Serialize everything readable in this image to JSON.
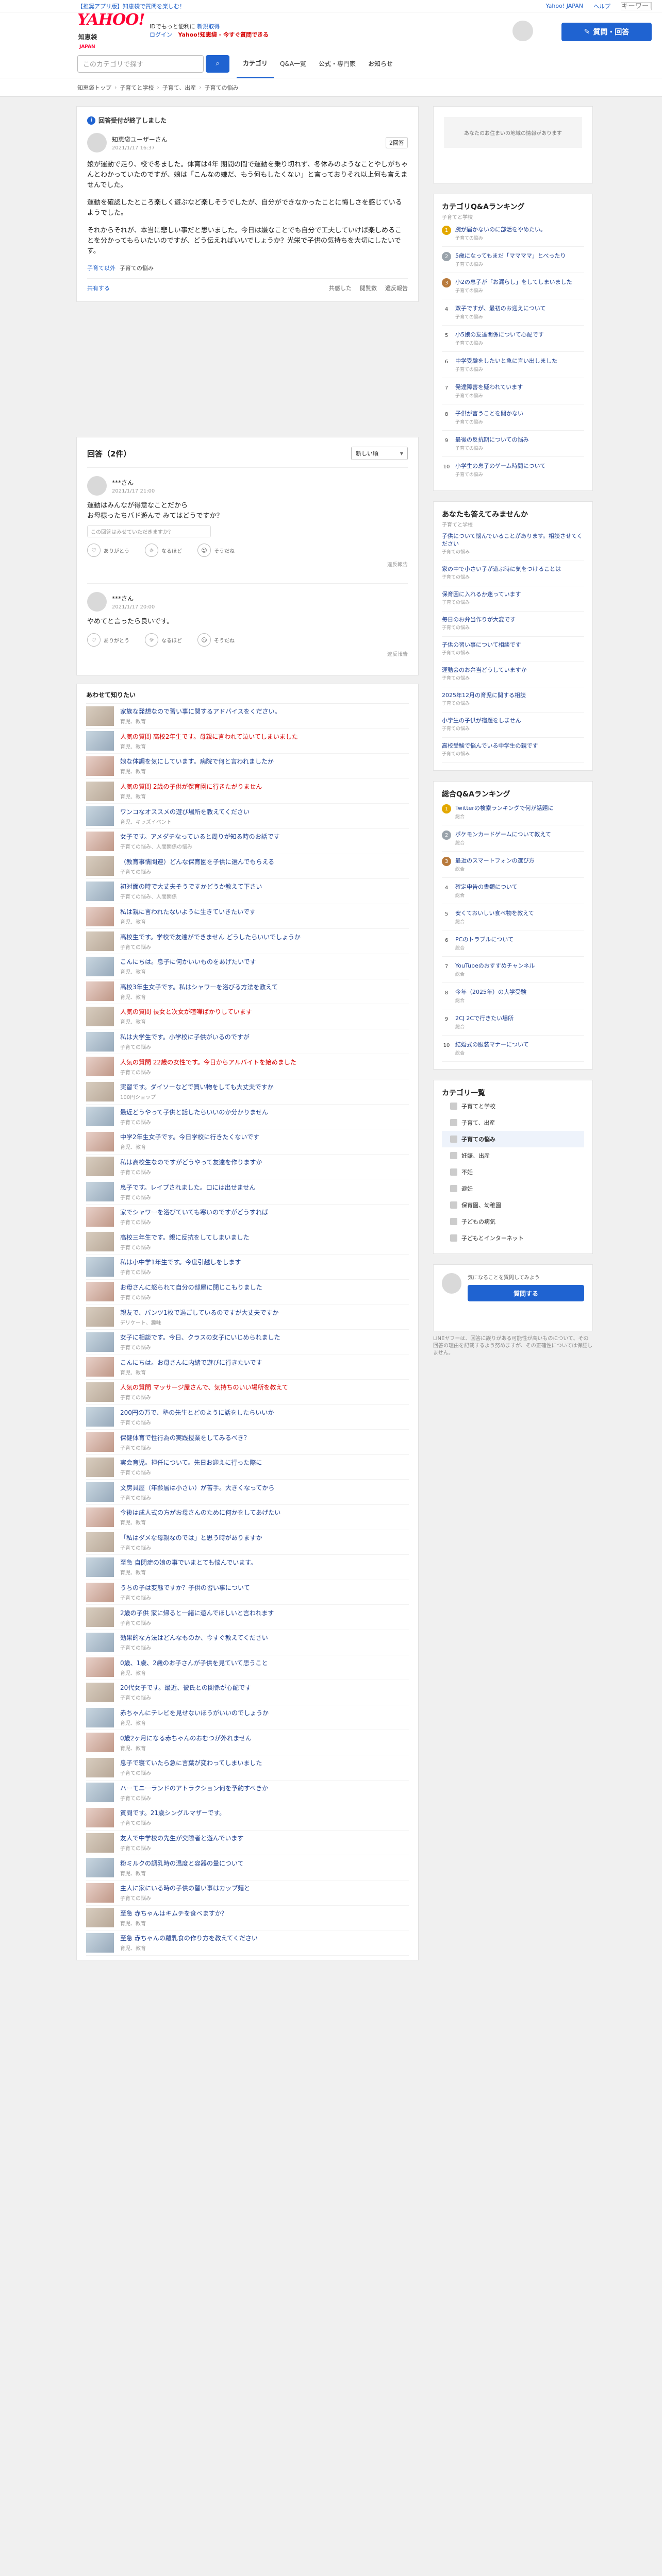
{
  "topbar": {
    "left_link": "【推奨アプリ版】知恵袋で質問を楽しむ！",
    "right": [
      "Yahoo! JAPAN",
      "ヘルプ",
      "キーワード検索"
    ]
  },
  "header": {
    "logo": "YAHOO!",
    "logo_sub": "知恵袋",
    "logo_jp": "JAPAN",
    "greeting": "IDでもっと便利に",
    "greeting_link": "新規取得",
    "login": "ログイン",
    "promo": "Yahoo!知恵袋 - 今すぐ質問できる",
    "ask_button": "質問・回答"
  },
  "subnav": [
    "知恵袋トップ",
    "子育てと学校",
    "子育て、出産",
    "子育ての悩み"
  ],
  "search": {
    "placeholder": "このカテゴリで探す",
    "tabs": [
      "カテゴリ",
      "Q&A一覧",
      "公式・専門家",
      "お知らせ"
    ]
  },
  "question": {
    "resolved": "回答受付が終了しました",
    "user": "知恵袋ユーザーさん",
    "date": "2021/1/17 16:37",
    "answer_count": "2回答",
    "body": [
      "娘が運動で走り、校で冬ました。体育は4年 期間の間で運動を乗り切れず、冬休みのようなことやしがちゃんとわかっていたのですが、娘は「こんなの嫌だ、もう何もしたくない」と言っておりそれ以上何も言えませんでした。",
      "運動を確認したところ楽しく遊ぶなど楽しそうでしたが、自分ができなかったことに悔しさを感じているようでした。",
      "それからそれが、本当に悲しい事だと思いました。今日は嫌なことでも自分で工夫していけば楽しめることを分かってもらいたいのですが、どう伝えればいいでしょうか？光栄で子供の気持ちを大切にしたいです。"
    ],
    "tag": "子育て以外",
    "category": "子育ての悩み",
    "actions": [
      "共感した",
      "閲覧数",
      "違反報告"
    ],
    "share": "共有する"
  },
  "answers": {
    "title": "回答（2件）",
    "sort": "新しい順",
    "items": [
      {
        "user": "***さん",
        "date": "2021/1/17 21:00",
        "text": "運動はみんなが得意なことだから\nお母様ったちバド遊んで みてはどうですか？",
        "ref": "この回答はみせていただきますか？",
        "reactions": [
          "ありがとう",
          "なるほど",
          "そうだね"
        ],
        "report": "違反報告"
      },
      {
        "user": "***さん",
        "date": "2021/1/17 20:00",
        "text": "やめてと言ったら良いです。",
        "reactions": [
          "ありがとう",
          "なるほど",
          "そうだね"
        ],
        "report": "違反報告"
      }
    ]
  },
  "related": {
    "title": "あわせて知りたい",
    "items": [
      {
        "t": "家族な発想なので習い事に関するアドバイスをください。",
        "s": "育児、教育"
      },
      {
        "t": "人気の質問 高校2年生です。母親に言われて泣いてしまいました",
        "s": "育児、教育",
        "pop": true
      },
      {
        "t": "娘な体調を気にしています。病院で何と言われましたか",
        "s": "育児、教育"
      },
      {
        "t": "人気の質問 2歳の子供が保育園に行きたがりません",
        "s": "育児、教育",
        "pop": true
      },
      {
        "t": "ワンコなオススメの遊び場所を教えてください",
        "s": "育児、キッズイベント"
      },
      {
        "t": "女子です。アメダチなっていると周りが知る時のお話です",
        "s": "子育ての悩み、人間関係の悩み"
      },
      {
        "t": "（教育事情関連）どんな保育園を子供に選んでもらえる",
        "s": "子育ての悩み"
      },
      {
        "t": "初対面の時で大丈夫そうですかどうか教えて下さい",
        "s": "子育ての悩み、人間関係"
      },
      {
        "t": "私は親に言われたないように生きていきたいです",
        "s": "育児、教育"
      },
      {
        "t": "高校生です。学校で友達ができません どうしたらいいでしょうか",
        "s": "子育ての悩み"
      },
      {
        "t": "こんにちは。息子に何かいいものをあげたいです",
        "s": "育児、教育"
      },
      {
        "t": "高校3年生女子です。私はシャワーを浴びる方法を教えて",
        "s": "育児、教育"
      },
      {
        "t": "人気の質問 長女と次女が喧嘩ばかりしています",
        "s": "育児、教育",
        "pop": true
      },
      {
        "t": "私は大学生です。小学校に子供がいるのですが",
        "s": "子育ての悩み"
      },
      {
        "t": "人気の質問 22歳の女性です。今日からアルバイトを始めました",
        "s": "子育ての悩み",
        "pop": true
      },
      {
        "t": "実習です。ダイソーなどで買い物をしても大丈夫ですか",
        "s": "100円ショップ"
      },
      {
        "t": "最近どうやって子供と話したらいいのか分かりません",
        "s": "子育ての悩み"
      },
      {
        "t": "中学2年生女子です。今日学校に行きたくないです",
        "s": "育児、教育"
      },
      {
        "t": "私は高校生なのですがどうやって友達を作りますか",
        "s": "子育ての悩み"
      },
      {
        "t": "息子です。レイプされました。口には出せません",
        "s": "子育ての悩み"
      },
      {
        "t": "家でシャワーを浴びていても寒いのですがどうすれば",
        "s": "子育ての悩み"
      },
      {
        "t": "高校三年生です。親に反抗をしてしまいました",
        "s": "子育ての悩み"
      },
      {
        "t": "私は小中学1年生です。今度引越しをします",
        "s": "子育ての悩み"
      },
      {
        "t": "お母さんに怒られて自分の部屋に閉じこもりました",
        "s": "子育ての悩み"
      },
      {
        "t": "親友で、パンツ1枚で過ごしているのですが大丈夫ですか",
        "s": "デリケート、趣味"
      },
      {
        "t": "女子に相談です。今日、クラスの女子にいじめられました",
        "s": "子育ての悩み"
      },
      {
        "t": "こんにちは。お母さんに内緒で遊びに行きたいです",
        "s": "育児、教育"
      },
      {
        "t": "人気の質問 マッサージ屋さんで、気持ちのいい場所を教えて",
        "s": "子育ての悩み",
        "pop": true
      },
      {
        "t": "200円の万で、塾の先生とどのように話をしたらいいか",
        "s": "子育ての悩み"
      },
      {
        "t": "保健体育で性行為の実践授業をしてみるべき？",
        "s": "子育ての悩み"
      },
      {
        "t": "実会育児。担任について。先日お迎えに行った際に",
        "s": "子育ての悩み"
      },
      {
        "t": "文房具屋（年齢層は小さい）が苦手。大きくなってから",
        "s": "子育ての悩み"
      },
      {
        "t": "今後は成人式の方がお母さんのために何かをしてあげたい",
        "s": "育児、教育"
      },
      {
        "t": "「私はダメな母親なのでは」と思う時がありますか",
        "s": "子育ての悩み"
      },
      {
        "t": "至急 自閉症の娘の事でいまとても悩んでいます。",
        "s": "育児、教育"
      },
      {
        "t": "うちの子は変態ですか？子供の習い事について",
        "s": "子育ての悩み"
      },
      {
        "t": "2歳の子供 家に帰ると一緒に遊んでほしいと言われます",
        "s": "子育ての悩み"
      },
      {
        "t": "効果的な方法はどんなものか、今すぐ教えてください",
        "s": "子育ての悩み"
      },
      {
        "t": "0歳、1歳、2歳のお子さんが子供を見ていて思うこと",
        "s": "育児、教育"
      },
      {
        "t": "20代女子です。最近、彼氏との関係が心配です",
        "s": "子育ての悩み"
      },
      {
        "t": "赤ちゃんにテレビを見せないほうがいいのでしょうか",
        "s": "育児、教育"
      },
      {
        "t": "0歳2ヶ月になる赤ちゃんのおむつが外れません",
        "s": "育児、教育"
      },
      {
        "t": "息子で寝ていたら急に言葉が変わってしまいました",
        "s": "子育ての悩み"
      },
      {
        "t": "ハーモニーランドのアトラクション何を予約すべきか",
        "s": "子育ての悩み"
      },
      {
        "t": "質問です。21歳シングルマザーです。",
        "s": "子育ての悩み"
      },
      {
        "t": "友人で中学校の先生が交際者と遊んでいます",
        "s": "子育ての悩み"
      },
      {
        "t": "粉ミルクの調乳時の温度と容器の量について",
        "s": "育児、教育"
      },
      {
        "t": "主人に家にいる時の子供の習い事はカップ麺と",
        "s": "子育ての悩み"
      },
      {
        "t": "至急 赤ちゃんはキムチを食べますか？",
        "s": "育児、教育"
      },
      {
        "t": "至急 赤ちゃんの離乳食の作り方を教えてください",
        "s": "育児、教育"
      }
    ]
  },
  "side": {
    "ad_label": "あなたのお住まいの地域の情報があります",
    "ranking_title": "カテゴリQ&Aランキング",
    "ranking_sub": "子育てと学校",
    "ranking": [
      {
        "t": "腕が届かないのに部活をやめたい。",
        "c": "子育ての悩み"
      },
      {
        "t": "5歳になってもまだ「ママママ」とべったり",
        "c": "子育ての悩み"
      },
      {
        "t": "小2の息子が「お漏らし」をしてしまいました",
        "c": "子育ての悩み"
      },
      {
        "t": "双子ですが、最初のお迎えについて",
        "c": "子育ての悩み"
      },
      {
        "t": "小5娘の友達関係について心配です",
        "c": "子育ての悩み"
      },
      {
        "t": "中学受験をしたいと急に言い出しました",
        "c": "子育ての悩み"
      },
      {
        "t": "発達障害を疑われています",
        "c": "子育ての悩み"
      },
      {
        "t": "子供が言うことを聞かない",
        "c": "子育ての悩み"
      },
      {
        "t": "最後の反抗期についての悩み",
        "c": "子育ての悩み"
      },
      {
        "t": "小学生の息子のゲーム時間について",
        "c": "子育ての悩み"
      }
    ],
    "reco_title": "あなたも答えてみませんか",
    "reco_sub": "子育てと学校",
    "recos": [
      {
        "t": "子供について悩んでいることがあります。相談させてください",
        "c": "子育ての悩み"
      },
      {
        "t": "家の中で小さい子が遊ぶ時に気をつけることは",
        "c": "子育ての悩み"
      },
      {
        "t": "保育園に入れるか迷っています",
        "c": "子育ての悩み"
      },
      {
        "t": "毎日のお弁当作りが大変です",
        "c": "子育ての悩み"
      },
      {
        "t": "子供の習い事について相談です",
        "c": "子育ての悩み"
      },
      {
        "t": "運動会のお弁当どうしていますか",
        "c": "子育ての悩み"
      },
      {
        "t": "2025年12月の育児に関する相談",
        "c": "子育ての悩み"
      },
      {
        "t": "小学生の子供が宿題をしません",
        "c": "子育ての悩み"
      },
      {
        "t": "高校受験で悩んでいる中学生の親です",
        "c": "子育ての悩み"
      }
    ],
    "overall_title": "総合Q&Aランキング",
    "overall": [
      {
        "t": "Twitterの検索ランキングで何が話題に",
        "c": "総合"
      },
      {
        "t": "ポケモンカードゲームについて教えて",
        "c": "総合"
      },
      {
        "t": "最近のスマートフォンの選び方",
        "c": "総合"
      },
      {
        "t": "確定申告の書類について",
        "c": "総合"
      },
      {
        "t": "安くておいしい食べ物を教えて",
        "c": "総合"
      },
      {
        "t": "PCのトラブルについて",
        "c": "総合"
      },
      {
        "t": "YouTubeのおすすめチャンネル",
        "c": "総合"
      },
      {
        "t": "今年（2025年）の大学受験",
        "c": "総合"
      },
      {
        "t": "2CJ 2Cで行きたい場所",
        "c": "総合"
      },
      {
        "t": "結婚式の服装マナーについて",
        "c": "総合"
      }
    ],
    "cat_title": "カテゴリ一覧",
    "cats": [
      "子育てと学校",
      "子育て、出産",
      "子育ての悩み",
      "妊娠、出産",
      "不妊",
      "避妊",
      "保育園、幼稚園",
      "子どもの病気",
      "子どもとインターネット"
    ],
    "ask_label": "気になることを質問してみよう",
    "ask_button": "質問する",
    "ask_note": "LINEヤフーは、回答に誤りがある可能性が高いものについて、その回答の理由を記載するよう努めますが、その正確性については保証しません。"
  }
}
